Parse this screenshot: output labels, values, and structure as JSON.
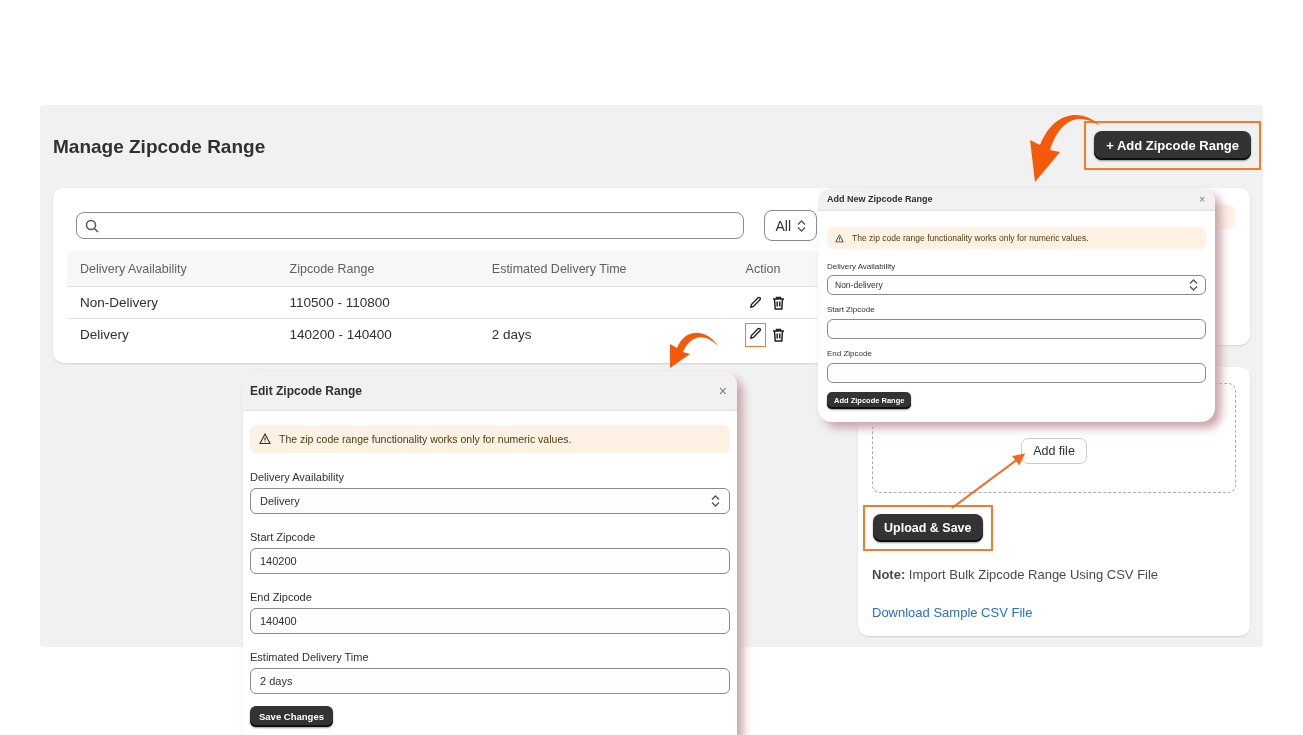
{
  "page": {
    "title": "Manage Zipcode Range",
    "add_button": {
      "label": "+ Add Zipcode Range",
      "highlighted": true
    }
  },
  "table": {
    "filter": "All",
    "columns": [
      "Delivery Availability",
      "Zipcode Range",
      "Estimated Delivery Time",
      "Action"
    ],
    "rows": [
      {
        "availability": "Non-Delivery",
        "range": "110500 - 110800",
        "edit_highlighted": false
      },
      {
        "availability": "Delivery",
        "range": "140200 - 140400",
        "time": "2 days",
        "edit_highlighted": true
      }
    ]
  },
  "upload": {
    "add_file": "Add file",
    "upload_button": {
      "label": "Upload & Save",
      "highlighted": true
    },
    "note": "**Note:** Import Bulk Zipcode Range Using CSV File",
    "download_link": "Download Sample CSV File"
  },
  "add_modal": {
    "title": "Add New Zipcode Range",
    "close": "×",
    "alert": "The zip code range functionality works only for numeric values.",
    "fields": [
      {
        "kind": "select",
        "label": "Delivery Availability",
        "value": "Non-delivery"
      },
      {
        "kind": "text",
        "label": "Start Zipcode"
      },
      {
        "kind": "text",
        "label": "End Zipcode"
      }
    ],
    "submit": "Add Zipcode Range"
  },
  "edit_modal": {
    "title": "Edit Zipcode Range",
    "close": "×",
    "alert": "The zip code range functionality works only for numeric values.",
    "fields": [
      {
        "kind": "select",
        "label": "Delivery Availability",
        "value": "Delivery"
      },
      {
        "kind": "text",
        "label": "Start Zipcode",
        "value": "140200"
      },
      {
        "kind": "text",
        "label": "End Zipcode",
        "value": "140400"
      },
      {
        "kind": "text",
        "label": "Estimated Delivery Time",
        "value": "2 days"
      }
    ],
    "submit": "Save Changes"
  }
}
